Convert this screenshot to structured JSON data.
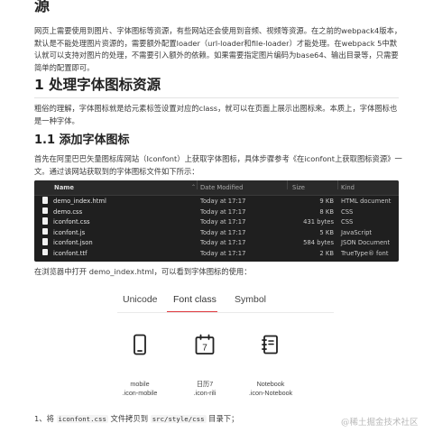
{
  "top_heading": "源",
  "intro_paragraph": "网页上需要使用到图片、字体图标等资源，有些网站还会使用到音频、视频等资源。在之前的webpack4版本，默认是不能处理图片资源的，需要额外配置loader（url-loader和file-loader）才能处理。在webpack 5中默认就可以支持对图片的处理，不需要引入额外的依赖。如果需要指定图片编码为base64、输出目录等，只需要简单的配置即可。",
  "section1_heading": "1 处理字体图标资源",
  "section1_paragraph": "粗俗的理解，字体图标就是给元素标签设置对应的class，就可以在页面上展示出图标来。本质上，字体图标也是一种字体。",
  "section11_heading": "1.1 添加字体图标",
  "section11_paragraph": "首先在阿里巴巴矢量图标库网站（Iconfont）上获取字体图标，具体步骤参考《在iconfont上获取图标资源》一文。通过该网站获取到的字体图标文件如下所示：",
  "file_table": {
    "headers": {
      "name": "Name",
      "date": "Date Modified",
      "size": "Size",
      "kind": "Kind"
    },
    "rows": [
      {
        "name": "demo_index.html",
        "date": "Today at 17:17",
        "size": "9 KB",
        "kind": "HTML document"
      },
      {
        "name": "demo.css",
        "date": "Today at 17:17",
        "size": "8 KB",
        "kind": "CSS"
      },
      {
        "name": "iconfont.css",
        "date": "Today at 17:17",
        "size": "431 bytes",
        "kind": "CSS"
      },
      {
        "name": "iconfont.js",
        "date": "Today at 17:17",
        "size": "5 KB",
        "kind": "JavaScript"
      },
      {
        "name": "iconfont.json",
        "date": "Today at 17:17",
        "size": "584 bytes",
        "kind": "JSON Document"
      },
      {
        "name": "iconfont.ttf",
        "date": "Today at 17:17",
        "size": "2 KB",
        "kind": "TrueType® font"
      }
    ]
  },
  "browser_paragraph": "在浏览器中打开 demo_index.html，可以看到字体图标的使用：",
  "demo": {
    "tabs": [
      "Unicode",
      "Font class",
      "Symbol"
    ],
    "active_tab": "Font class",
    "icons": [
      {
        "icon": "mobile-icon",
        "name": "mobile",
        "class": ".icon-mobile"
      },
      {
        "icon": "calendar-icon",
        "name": "日历7",
        "class": ".icon-rili",
        "badge": "7"
      },
      {
        "icon": "notebook-icon",
        "name": "Notebook",
        "class": ".icon-Notebook"
      }
    ]
  },
  "step1": {
    "prefix": "1、将 ",
    "code1": "iconfont.css",
    "middle": " 文件拷贝到 ",
    "code2": "src/style/css",
    "suffix": " 目录下；"
  },
  "watermark": "@稀土掘金技术社区",
  "colors": {
    "accent": "#e0393e",
    "table_bg": "#1f1f1f"
  }
}
